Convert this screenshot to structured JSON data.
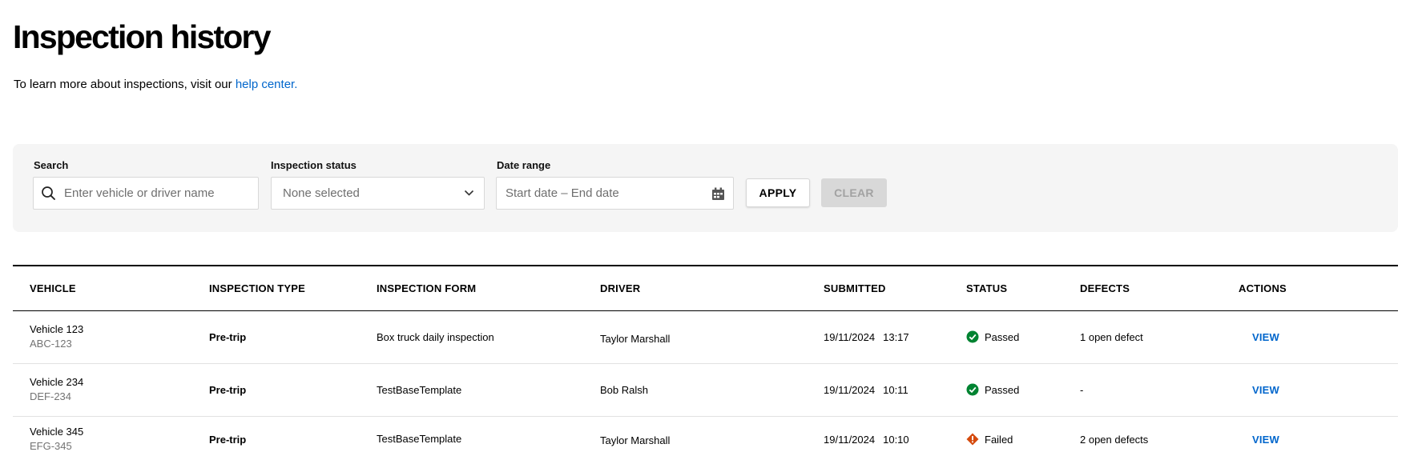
{
  "page": {
    "title": "Inspection history",
    "intro_text": "To learn more about inspections, visit our ",
    "help_link": "help center."
  },
  "filters": {
    "search": {
      "label": "Search",
      "placeholder": "Enter vehicle or driver name"
    },
    "status": {
      "label": "Inspection status",
      "value": "None selected"
    },
    "date_range": {
      "label": "Date range",
      "placeholder": "Start date – End date"
    },
    "apply_label": "APPLY",
    "clear_label": "CLEAR"
  },
  "table": {
    "columns": [
      "VEHICLE",
      "INSPECTION TYPE",
      "INSPECTION FORM",
      "DRIVER",
      "SUBMITTED",
      "STATUS",
      "DEFECTS",
      "ACTIONS"
    ],
    "rows": [
      {
        "vehicle": "Vehicle 123",
        "plate": "ABC-123",
        "type": "Pre-trip",
        "form": "Box truck daily inspection",
        "driver": "Taylor Marshall",
        "date": "19/11/2024",
        "time": "13:17",
        "status": "Passed",
        "status_icon": "check-circle-icon",
        "defects": "1 open defect",
        "action": "VIEW"
      },
      {
        "vehicle": "Vehicle 234",
        "plate": "DEF-234",
        "type": "Pre-trip",
        "form": "TestBaseTemplate",
        "driver": "Bob Ralsh",
        "date": "19/11/2024",
        "time": "10:11",
        "status": "Passed",
        "status_icon": "check-circle-icon",
        "defects": "-",
        "action": "VIEW"
      },
      {
        "vehicle": "Vehicle 345",
        "plate": "EFG-345",
        "type": "Pre-trip",
        "form": "TestBaseTemplate",
        "driver": "Taylor Marshall",
        "date": "19/11/2024",
        "time": "10:10",
        "status": "Failed",
        "status_icon": "warning-diamond-icon",
        "defects": "2 open defects",
        "action": "VIEW"
      }
    ]
  },
  "colors": {
    "link": "#0066cc",
    "passed": "#008331",
    "failed": "#d54a0d",
    "panel_bg": "#f5f5f5"
  }
}
